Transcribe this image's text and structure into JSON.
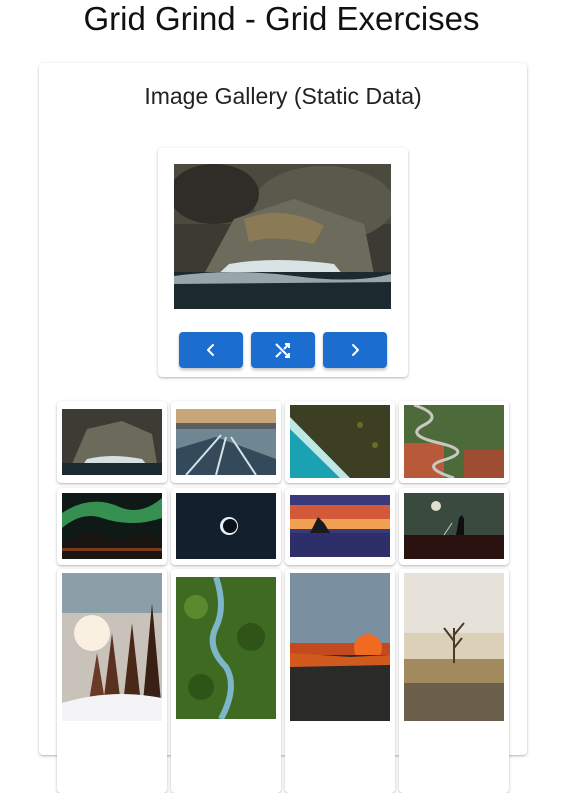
{
  "page": {
    "title": "Grid Grind - Grid Exercises"
  },
  "gallery": {
    "title": "Image Gallery (Static Data)",
    "controls": {
      "prev_icon": "chevron-left-icon",
      "shuffle_icon": "shuffle-icon",
      "next_icon": "chevron-right-icon"
    },
    "thumbnails": [
      {
        "subject": "sea lions on rock",
        "icon": "sea-lions-photo"
      },
      {
        "subject": "frozen lake",
        "icon": "frozen-lake-photo"
      },
      {
        "subject": "aerial coastline",
        "icon": "aerial-coast-photo"
      },
      {
        "subject": "winding road",
        "icon": "winding-road-photo"
      },
      {
        "subject": "aurora",
        "icon": "aurora-photo"
      },
      {
        "subject": "eclipse",
        "icon": "eclipse-photo"
      },
      {
        "subject": "sea stack sunset",
        "icon": "sunset-photo"
      },
      {
        "subject": "figure with moon",
        "icon": "moon-figure-photo"
      },
      {
        "subject": "snowy forest",
        "icon": "snowy-forest-photo"
      },
      {
        "subject": "river in forest",
        "icon": "river-forest-photo"
      },
      {
        "subject": "rain glass sunset",
        "icon": "rain-glass-photo"
      },
      {
        "subject": "lone tree",
        "icon": "lone-tree-photo"
      }
    ]
  },
  "colors": {
    "button": "#1c6dd0"
  }
}
